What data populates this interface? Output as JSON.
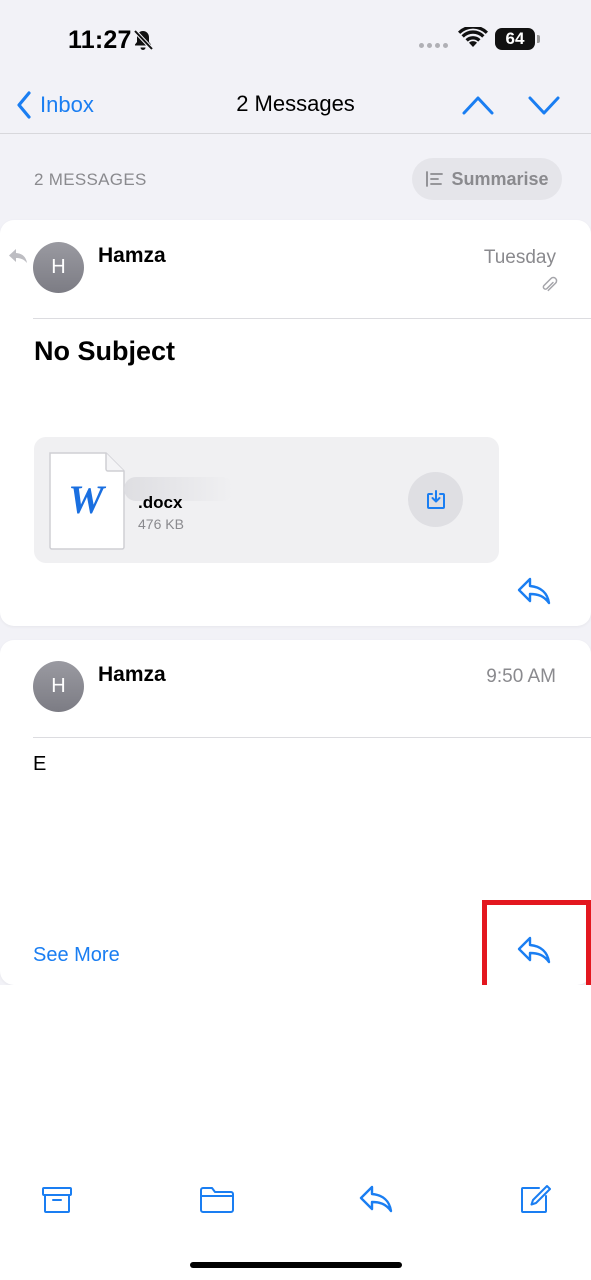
{
  "status_bar": {
    "time": "11:27",
    "battery": "64"
  },
  "nav": {
    "back_label": "Inbox",
    "title": "2 Messages"
  },
  "thread": {
    "count_label": "2 MESSAGES",
    "summarise_label": "Summarise"
  },
  "messages": [
    {
      "avatar_initial": "H",
      "sender": "Hamza",
      "date": "Tuesday",
      "subject": "No Subject",
      "attachment": {
        "name": ".docx",
        "size": "476 KB",
        "icon_letter": "W"
      }
    },
    {
      "avatar_initial": "H",
      "sender": "Hamza",
      "date": "9:50 AM",
      "body": "E",
      "see_more_label": "See More"
    }
  ],
  "colors": {
    "accent": "#1a7ef2",
    "highlight": "#e3171f"
  }
}
